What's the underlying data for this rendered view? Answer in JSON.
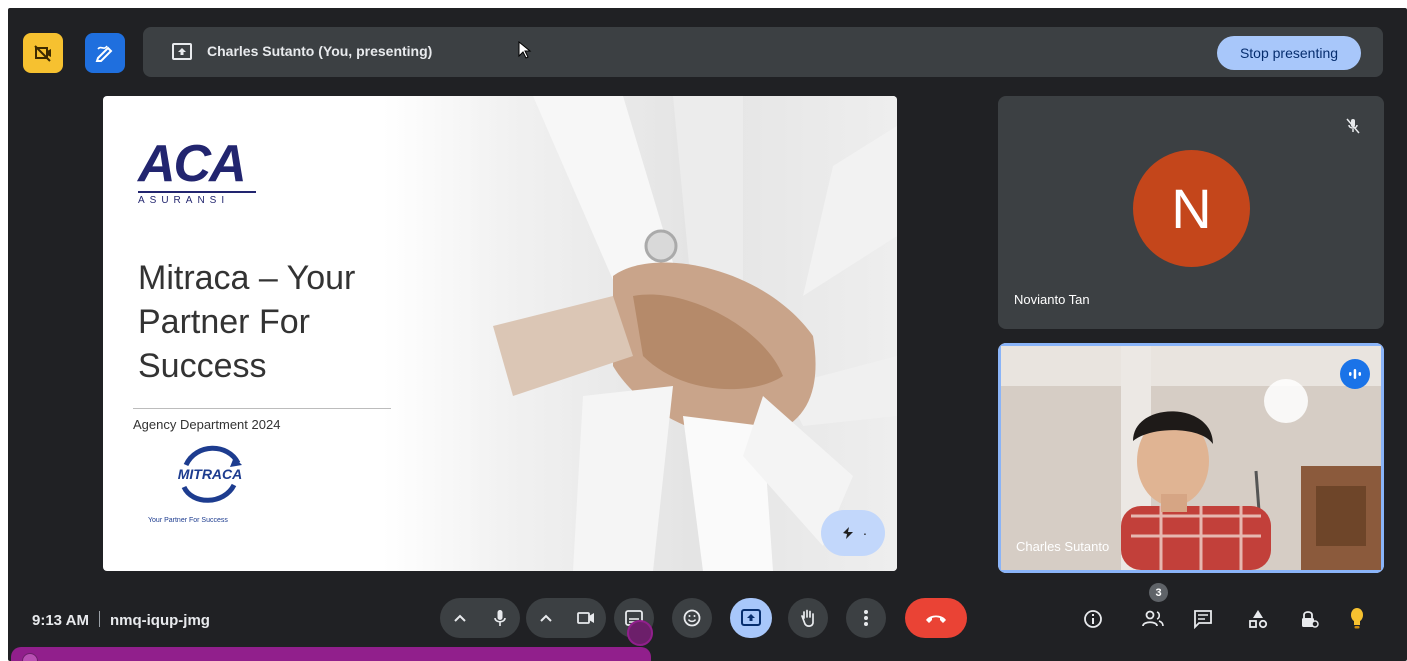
{
  "presenting": {
    "label": "Charles Sutanto (You, presenting)",
    "stop_label": "Stop presenting"
  },
  "slide": {
    "logo_main": "ACA",
    "logo_sub": "ASURANSI",
    "title_line1": "Mitraca – Your",
    "title_line2": "Partner For",
    "title_line3": "Success",
    "subtitle": "Agency Department 2024",
    "brand": "MITRACA",
    "tagline": "Your Partner For Success"
  },
  "participants": [
    {
      "name": "Novianto Tan",
      "initial": "N",
      "muted": true
    },
    {
      "name": "Charles Sutanto",
      "speaking": true
    }
  ],
  "meeting": {
    "time": "9:13 AM",
    "code": "nmq-iqup-jmg",
    "people_count": "3"
  },
  "colors": {
    "background": "#202124",
    "surface": "#3c4043",
    "accent": "#a8c7fa",
    "end_call": "#ea4335",
    "avatar": "#c4461b",
    "overlay": "#911f8c"
  },
  "icons": {
    "camera_off": "camera-off-icon",
    "annotate": "annotate-icon",
    "present": "present-to-all-icon",
    "mic": "mic-icon",
    "video": "videocam-icon",
    "captions": "captions-icon",
    "emoji": "emoji-icon",
    "hand": "raise-hand-icon",
    "more": "more-vert-icon",
    "end": "call-end-icon",
    "info": "info-icon",
    "people": "people-icon",
    "chat": "chat-icon",
    "activities": "activities-icon",
    "host": "host-controls-icon",
    "lightbulb": "lightbulb-icon"
  }
}
